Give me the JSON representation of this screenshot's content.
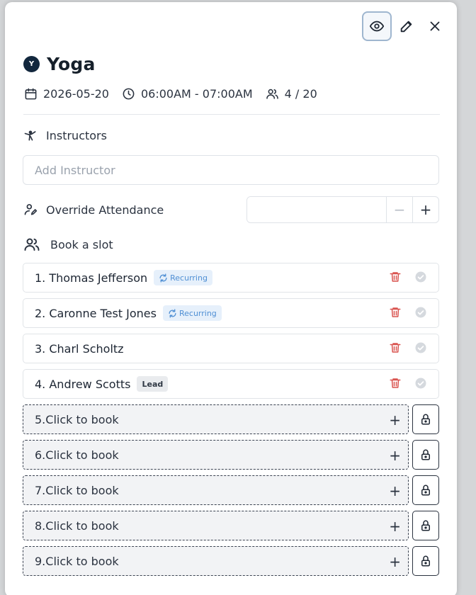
{
  "header": {
    "view_icon": "eye-icon",
    "edit_icon": "pencil-icon",
    "close_icon": "close-icon"
  },
  "event": {
    "badge_letter": "Y",
    "title": "Yoga",
    "date": "2026-05-20",
    "time": "06:00AM - 07:00AM",
    "capacity": "4 / 20"
  },
  "instructors": {
    "label": "Instructors",
    "placeholder": "Add Instructor"
  },
  "override": {
    "label": "Override Attendance",
    "value": "",
    "minus": "−",
    "plus": "+"
  },
  "booking": {
    "label": "Book a slot",
    "booked": [
      {
        "name": "1. Thomas Jefferson",
        "tag": "Recurring",
        "tag_type": "recurring"
      },
      {
        "name": "2. Caronne Test Jones",
        "tag": "Recurring",
        "tag_type": "recurring"
      },
      {
        "name": "3. Charl Scholtz",
        "tag": "",
        "tag_type": ""
      },
      {
        "name": "4. Andrew Scotts",
        "tag": "Lead",
        "tag_type": "lead"
      }
    ],
    "empty": [
      {
        "label": "5.Click to book",
        "plus": "+"
      },
      {
        "label": "6.Click to book",
        "plus": "+"
      },
      {
        "label": "7.Click to book",
        "plus": "+"
      },
      {
        "label": "8.Click to book",
        "plus": "+"
      },
      {
        "label": "9.Click to book",
        "plus": "+"
      }
    ]
  },
  "colors": {
    "accent_navy": "#12273d",
    "recurring_blue": "#4f8fd4",
    "delete_red": "#d9534f",
    "check_grey": "#c9ced4"
  }
}
